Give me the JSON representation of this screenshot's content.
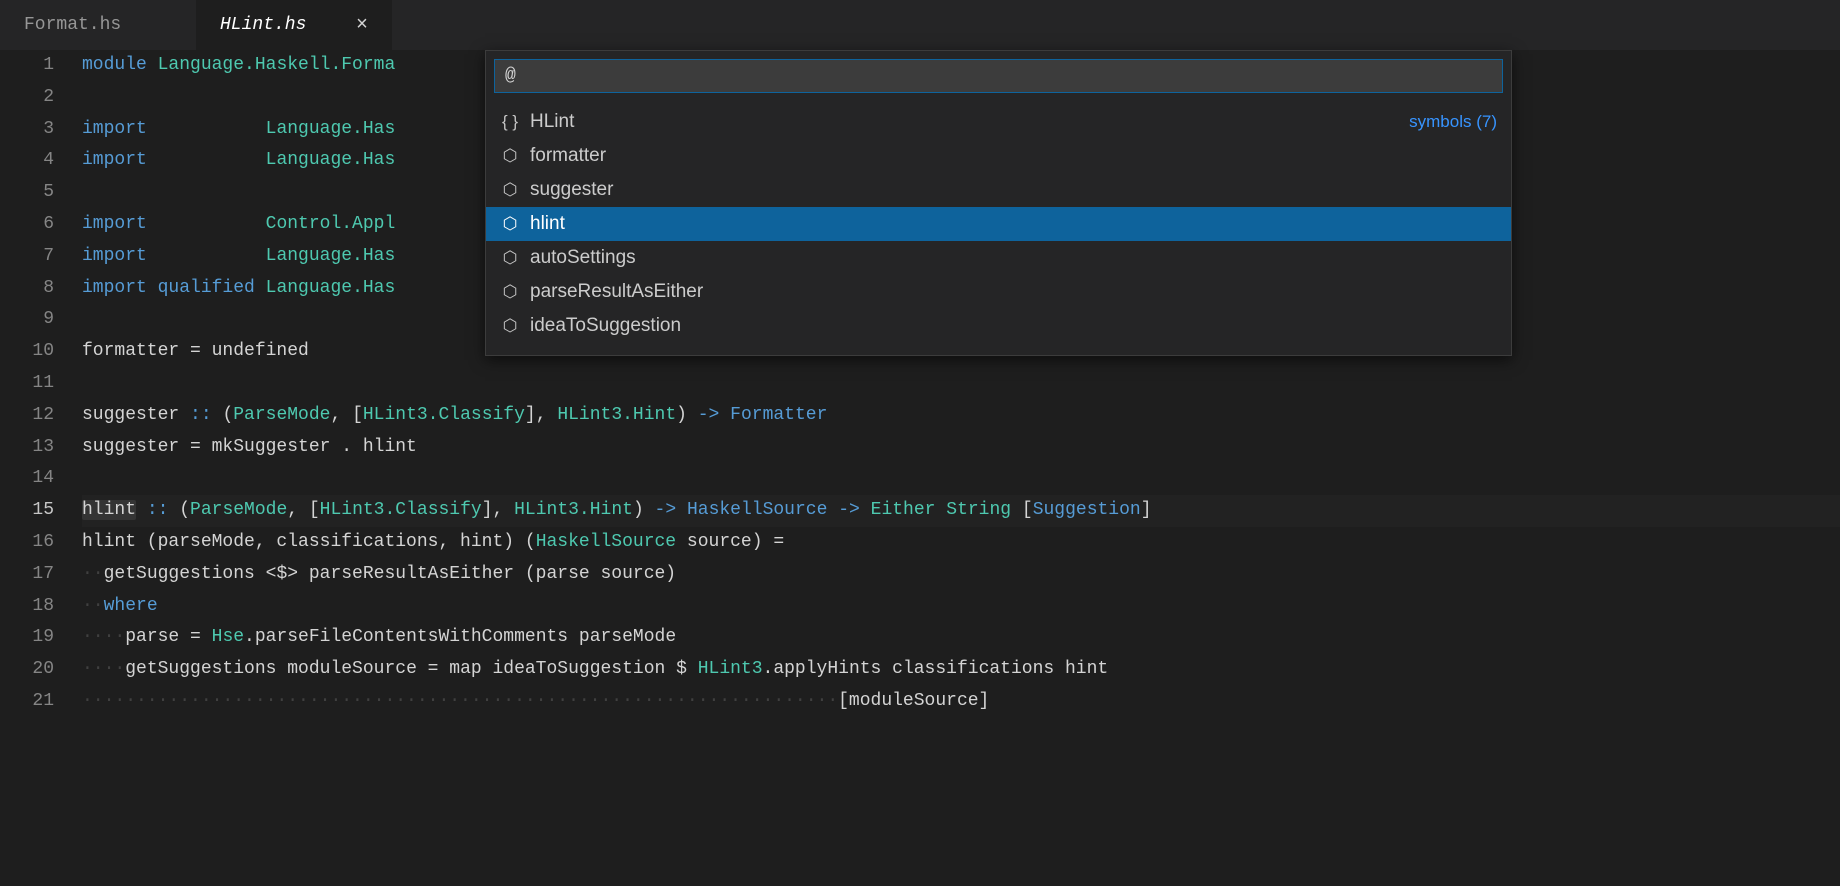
{
  "tabs": [
    {
      "label": "Format.hs",
      "active": false
    },
    {
      "label": "HLint.hs",
      "active": true
    }
  ],
  "quickopen": {
    "value": "@",
    "rightCounter": "symbols (7)",
    "items": [
      {
        "icon": "braces",
        "label": "HLint",
        "selected": false,
        "showCounter": true
      },
      {
        "icon": "cube",
        "label": "formatter",
        "selected": false
      },
      {
        "icon": "cube",
        "label": "suggester",
        "selected": false
      },
      {
        "icon": "cube",
        "label": "hlint",
        "selected": true
      },
      {
        "icon": "cube",
        "label": "autoSettings",
        "selected": false
      },
      {
        "icon": "cube",
        "label": "parseResultAsEither",
        "selected": false
      },
      {
        "icon": "cube",
        "label": "ideaToSuggestion",
        "selected": false
      }
    ]
  },
  "lines": {
    "1": [
      {
        "c": "kw-module",
        "t": "module"
      },
      {
        "c": "plain",
        "t": " "
      },
      {
        "c": "type",
        "t": "Language.Haskell.Forma"
      }
    ],
    "2": [],
    "3": [
      {
        "c": "kw-import",
        "t": "import"
      },
      {
        "c": "plain",
        "t": "           "
      },
      {
        "c": "type",
        "t": "Language.Has"
      }
    ],
    "4": [
      {
        "c": "kw-import",
        "t": "import"
      },
      {
        "c": "plain",
        "t": "           "
      },
      {
        "c": "type",
        "t": "Language.Has"
      }
    ],
    "5": [],
    "6": [
      {
        "c": "kw-import",
        "t": "import"
      },
      {
        "c": "plain",
        "t": "           "
      },
      {
        "c": "type",
        "t": "Control.Appl"
      }
    ],
    "7": [
      {
        "c": "kw-import",
        "t": "import"
      },
      {
        "c": "plain",
        "t": "           "
      },
      {
        "c": "type",
        "t": "Language.Has"
      }
    ],
    "8": [
      {
        "c": "kw-import",
        "t": "import"
      },
      {
        "c": "plain",
        "t": " "
      },
      {
        "c": "kw-qualified",
        "t": "qualified"
      },
      {
        "c": "plain",
        "t": " "
      },
      {
        "c": "type",
        "t": "Language.Has"
      }
    ],
    "9": [],
    "10": [
      {
        "c": "plain",
        "t": "formatter = undefined"
      }
    ],
    "11": [],
    "12": [
      {
        "c": "plain",
        "t": "suggester "
      },
      {
        "c": "op",
        "t": "::"
      },
      {
        "c": "plain",
        "t": " ("
      },
      {
        "c": "type",
        "t": "ParseMode"
      },
      {
        "c": "plain",
        "t": ", ["
      },
      {
        "c": "type",
        "t": "HLint3.Classify"
      },
      {
        "c": "plain",
        "t": "], "
      },
      {
        "c": "type",
        "t": "HLint3.Hint"
      },
      {
        "c": "plain",
        "t": ") "
      },
      {
        "c": "op",
        "t": "->"
      },
      {
        "c": "plain",
        "t": " "
      },
      {
        "c": "typeOther",
        "t": "Formatter"
      }
    ],
    "13": [
      {
        "c": "plain",
        "t": "suggester = mkSuggester . hlint"
      }
    ],
    "14": [],
    "15": [
      {
        "c": "plain sel",
        "t": "hlint"
      },
      {
        "c": "plain",
        "t": " "
      },
      {
        "c": "op",
        "t": "::"
      },
      {
        "c": "plain",
        "t": " ("
      },
      {
        "c": "type",
        "t": "ParseMode"
      },
      {
        "c": "plain",
        "t": ", ["
      },
      {
        "c": "type",
        "t": "HLint3.Classify"
      },
      {
        "c": "plain",
        "t": "], "
      },
      {
        "c": "type",
        "t": "HLint3.Hint"
      },
      {
        "c": "plain",
        "t": ") "
      },
      {
        "c": "op",
        "t": "->"
      },
      {
        "c": "plain",
        "t": " "
      },
      {
        "c": "typeOther",
        "t": "HaskellSource"
      },
      {
        "c": "plain",
        "t": " "
      },
      {
        "c": "op",
        "t": "->"
      },
      {
        "c": "plain",
        "t": " "
      },
      {
        "c": "type",
        "t": "Either"
      },
      {
        "c": "plain",
        "t": " "
      },
      {
        "c": "type",
        "t": "String"
      },
      {
        "c": "plain",
        "t": " ["
      },
      {
        "c": "typeOther",
        "t": "Suggestion"
      },
      {
        "c": "plain",
        "t": "]"
      }
    ],
    "16": [
      {
        "c": "plain",
        "t": "hlint (parseMode, classifications, hint) ("
      },
      {
        "c": "type",
        "t": "HaskellSource"
      },
      {
        "c": "plain",
        "t": " source) ="
      }
    ],
    "17": [
      {
        "c": "whitespace-dot",
        "t": "··"
      },
      {
        "c": "plain",
        "t": "getSuggestions <$> parseResultAsEither (parse source)"
      }
    ],
    "18": [
      {
        "c": "whitespace-dot",
        "t": "··"
      },
      {
        "c": "kw-where",
        "t": "where"
      }
    ],
    "19": [
      {
        "c": "whitespace-dot",
        "t": "····"
      },
      {
        "c": "plain",
        "t": "parse = "
      },
      {
        "c": "type",
        "t": "Hse"
      },
      {
        "c": "plain",
        "t": ".parseFileContentsWithComments parseMode"
      }
    ],
    "20": [
      {
        "c": "whitespace-dot",
        "t": "····"
      },
      {
        "c": "plain",
        "t": "getSuggestions moduleSource = map ideaToSuggestion $ "
      },
      {
        "c": "type",
        "t": "HLint3"
      },
      {
        "c": "plain",
        "t": ".applyHints classifications hint"
      }
    ],
    "21": [
      {
        "c": "whitespace-dot",
        "t": "······································································"
      },
      {
        "c": "plain",
        "t": "[moduleSource]"
      }
    ]
  },
  "currentLine": 15,
  "lineCount": 21
}
